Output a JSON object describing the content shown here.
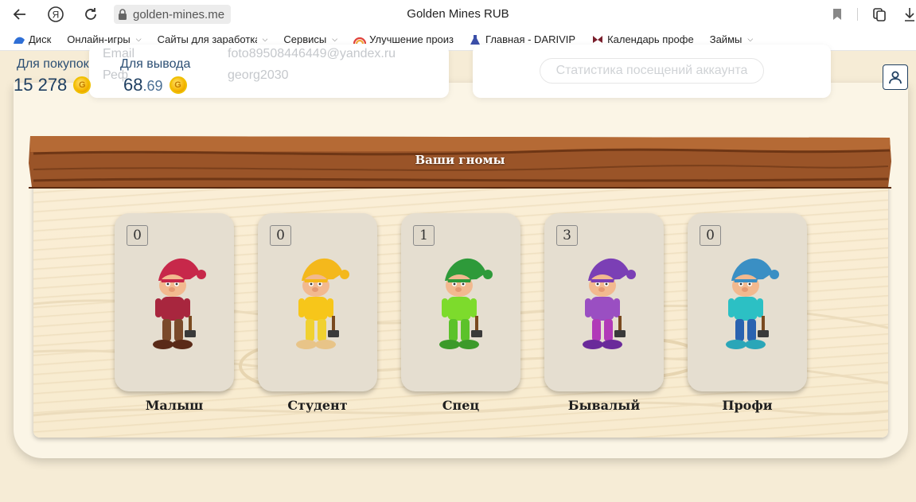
{
  "browser": {
    "url": "golden-mines.me",
    "tab_title": "Golden Mines RUB",
    "bookmarks": [
      {
        "label": "Диск",
        "has_menu": false
      },
      {
        "label": "Онлайн-игры",
        "has_menu": true
      },
      {
        "label": "Сайты для заработка",
        "has_menu": true
      },
      {
        "label": "Сервисы",
        "has_menu": true
      },
      {
        "label": "Улучшение произ",
        "has_menu": false
      },
      {
        "label": "Главная - DARIVIP",
        "has_menu": false
      },
      {
        "label": "Календарь профе",
        "has_menu": false
      },
      {
        "label": "Займы",
        "has_menu": true
      }
    ]
  },
  "profile": {
    "email_label": "Email",
    "referral_label": "Реф",
    "email": "foto89508446449@yandex.ru",
    "username": "georg2030",
    "stats_button": "Статистика посещений аккаунта"
  },
  "balance": {
    "purchase_label": "Для покупок",
    "purchase_value": "15 278",
    "withdraw_label": "Для вывода",
    "withdraw_int": "68",
    "withdraw_frac": ".69",
    "coin_letter": "G"
  },
  "gnomes": {
    "title": "Ваши гномы",
    "items": [
      {
        "name": "Малыш",
        "count": "0",
        "hat": "#c7284a",
        "shirt": "#a8263e",
        "pants": "#7a4a2a",
        "boots": "#5a2a18"
      },
      {
        "name": "Студент",
        "count": "0",
        "hat": "#f4b81c",
        "shirt": "#f7c61a",
        "pants": "#f0d130",
        "boots": "#e8c488"
      },
      {
        "name": "Спец",
        "count": "1",
        "hat": "#2e9a3a",
        "shirt": "#7ddb2c",
        "pants": "#5cc22a",
        "boots": "#3c9a2a"
      },
      {
        "name": "Бывалый",
        "count": "3",
        "hat": "#7b3fb5",
        "shirt": "#9a4fc2",
        "pants": "#b13ab8",
        "boots": "#6a2a9a"
      },
      {
        "name": "Профи",
        "count": "0",
        "hat": "#3a8fc4",
        "shirt": "#2cc0c4",
        "pants": "#2a62b0",
        "boots": "#2aa6b8"
      }
    ]
  },
  "colors": {
    "accent": "#1f3f61",
    "wood": "#8b4a22",
    "board": "#f8ebcf"
  }
}
